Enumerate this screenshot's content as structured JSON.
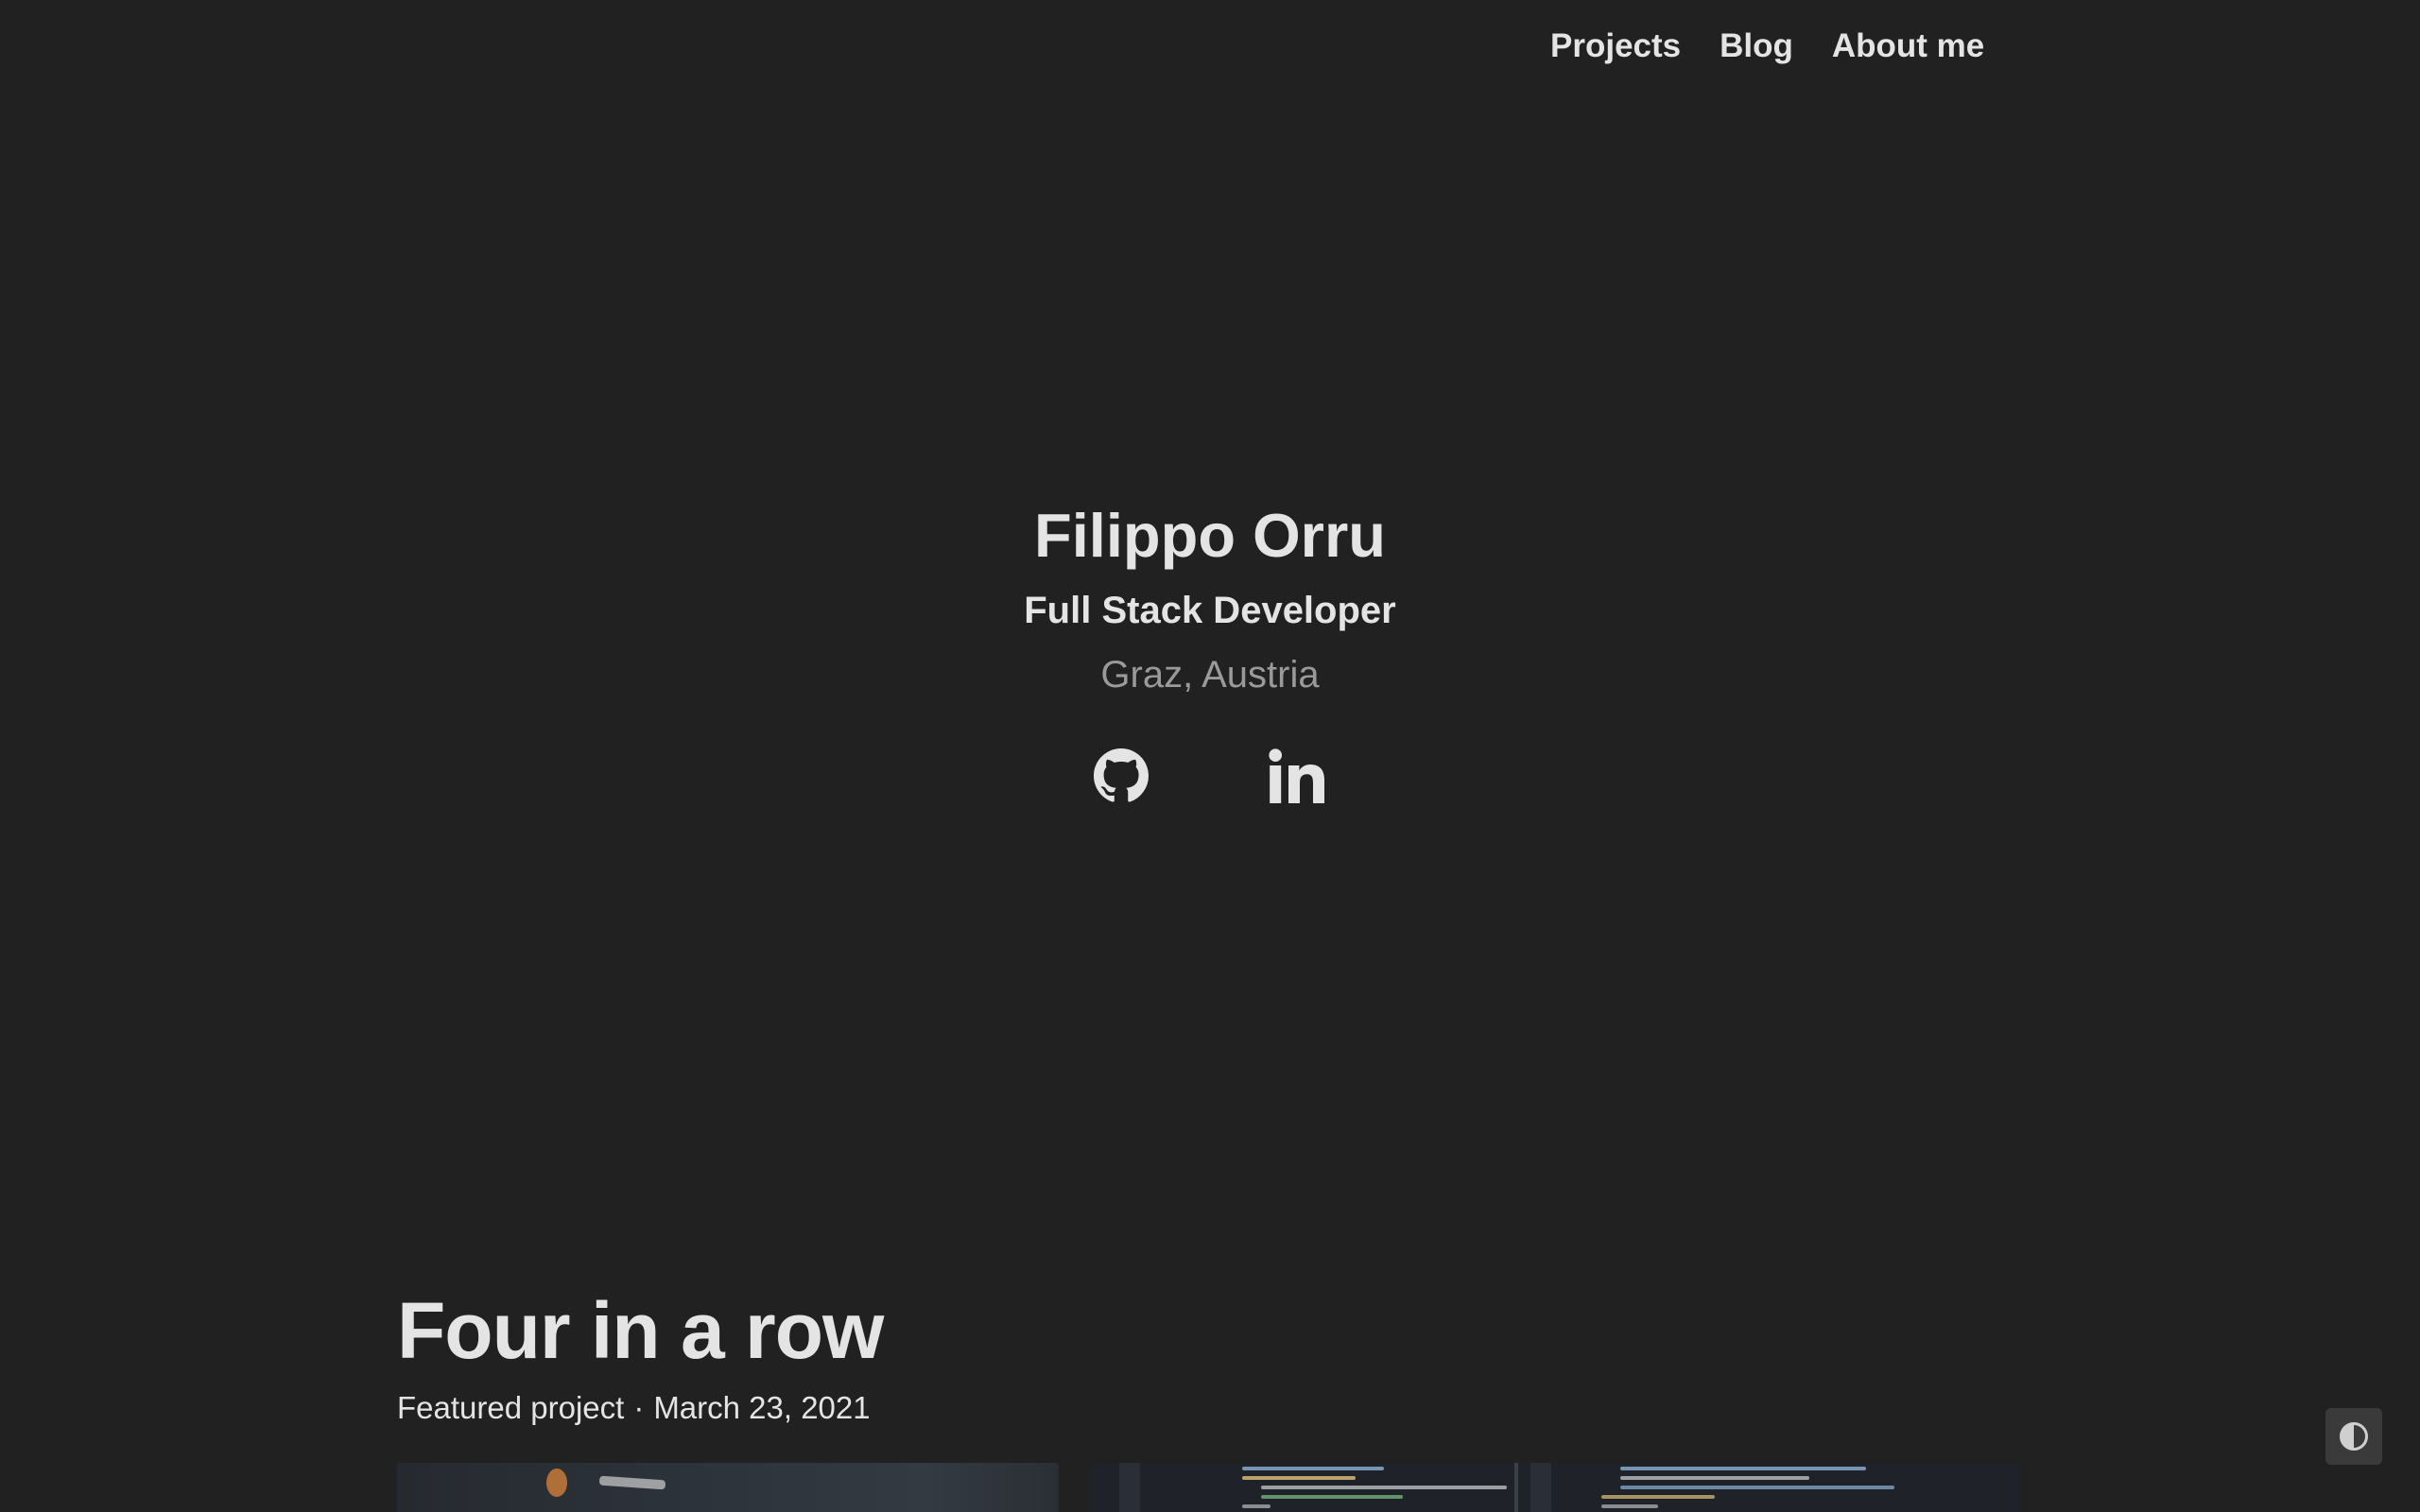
{
  "nav": {
    "items": [
      {
        "label": "Projects"
      },
      {
        "label": "Blog"
      },
      {
        "label": "About me"
      }
    ]
  },
  "hero": {
    "name": "Filippo Orru",
    "role": "Full Stack Developer",
    "location": "Graz, Austria",
    "socials": [
      {
        "icon": "github-icon"
      },
      {
        "icon": "linkedin-icon"
      }
    ]
  },
  "featured": {
    "title": "Four in a row",
    "label": "Featured project",
    "separator": "·",
    "date": "March 23, 2021"
  },
  "theme_toggle": {
    "icon": "contrast-icon"
  },
  "colors": {
    "background": "#212121",
    "text": "#e4e4e4",
    "muted": "#9a9a9a",
    "toggle_bg": "#3a3a3a"
  }
}
